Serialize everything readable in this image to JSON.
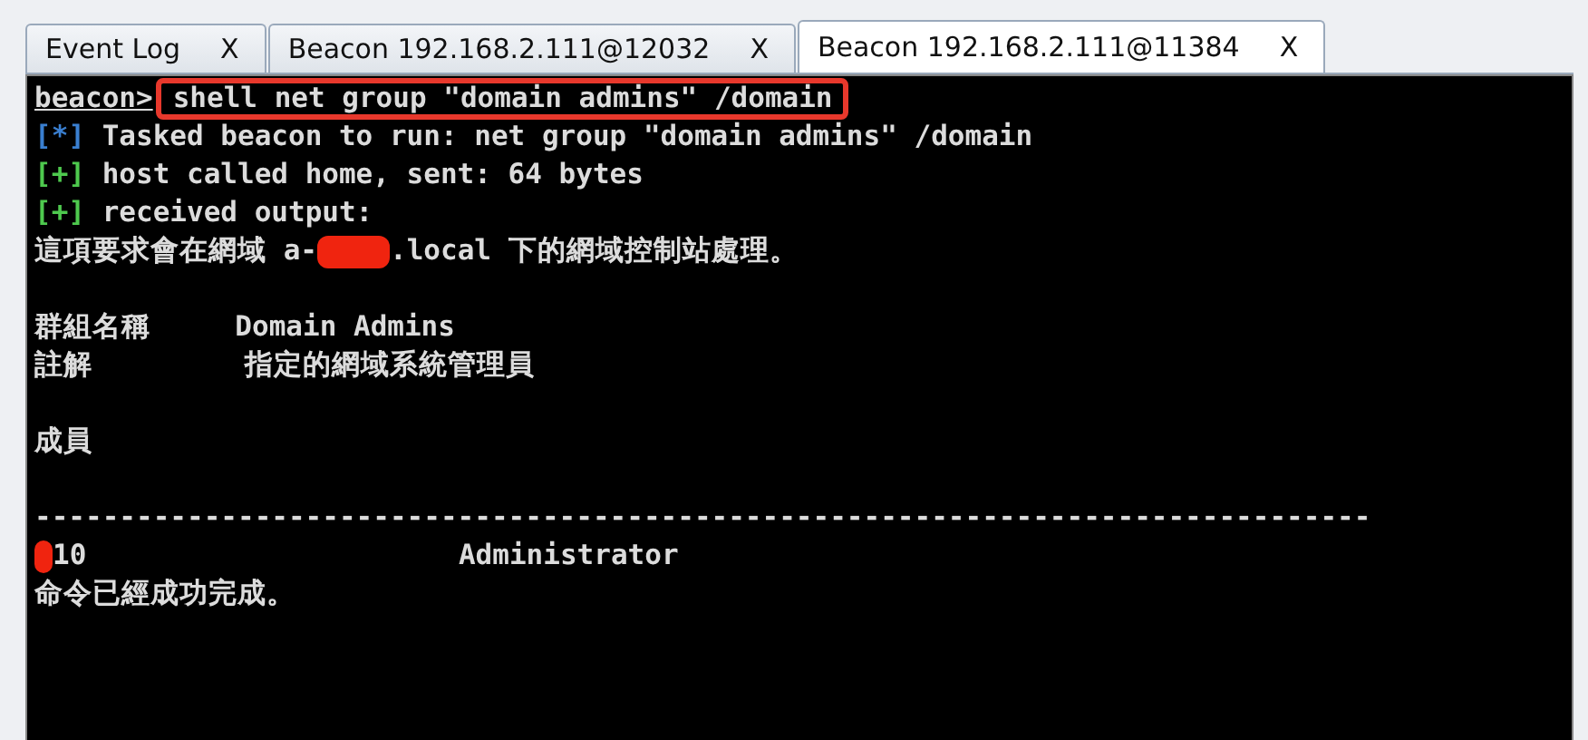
{
  "tabs": [
    {
      "label": "Event Log",
      "close": "X",
      "selected": false
    },
    {
      "label": "Beacon 192.168.2.111@12032",
      "close": "X",
      "selected": false
    },
    {
      "label": "Beacon 192.168.2.111@11384",
      "close": "X",
      "selected": true
    }
  ],
  "console": {
    "lines": [
      {
        "kind": "prompt",
        "prompt": "beacon>",
        "text": "shell net group \"domain admins\" /domain",
        "highlighted": true
      },
      {
        "kind": "info",
        "marker": "[*]",
        "text": "Tasked beacon to run: net group \"domain admins\" /domain"
      },
      {
        "kind": "success",
        "marker": "[+]",
        "text": "host called home, sent: 64 bytes"
      },
      {
        "kind": "success",
        "marker": "[+]",
        "text": "received output:"
      },
      {
        "kind": "output",
        "segments": [
          {
            "kind": "text",
            "text": "這項要求會在網域 a-"
          },
          {
            "kind": "redacted"
          },
          {
            "kind": "text",
            "text": ".local 下的網域控制站處理。"
          }
        ]
      },
      {
        "kind": "blank"
      },
      {
        "kind": "output",
        "segments": [
          {
            "kind": "text",
            "text": "群組名稱     Domain Admins"
          }
        ]
      },
      {
        "kind": "output",
        "segments": [
          {
            "kind": "text",
            "text": "註解         指定的網域系統管理員"
          }
        ]
      },
      {
        "kind": "blank"
      },
      {
        "kind": "output",
        "segments": [
          {
            "kind": "text",
            "text": "成員"
          }
        ]
      },
      {
        "kind": "blank"
      },
      {
        "kind": "output",
        "segments": [
          {
            "kind": "text",
            "text": "-------------------------------------------------------------------------------"
          }
        ]
      },
      {
        "kind": "output",
        "segments": [
          {
            "kind": "redacted"
          },
          {
            "kind": "text",
            "text": "10                      Administrator"
          }
        ]
      },
      {
        "kind": "output",
        "segments": [
          {
            "kind": "text",
            "text": "命令已經成功完成。"
          }
        ]
      }
    ]
  }
}
